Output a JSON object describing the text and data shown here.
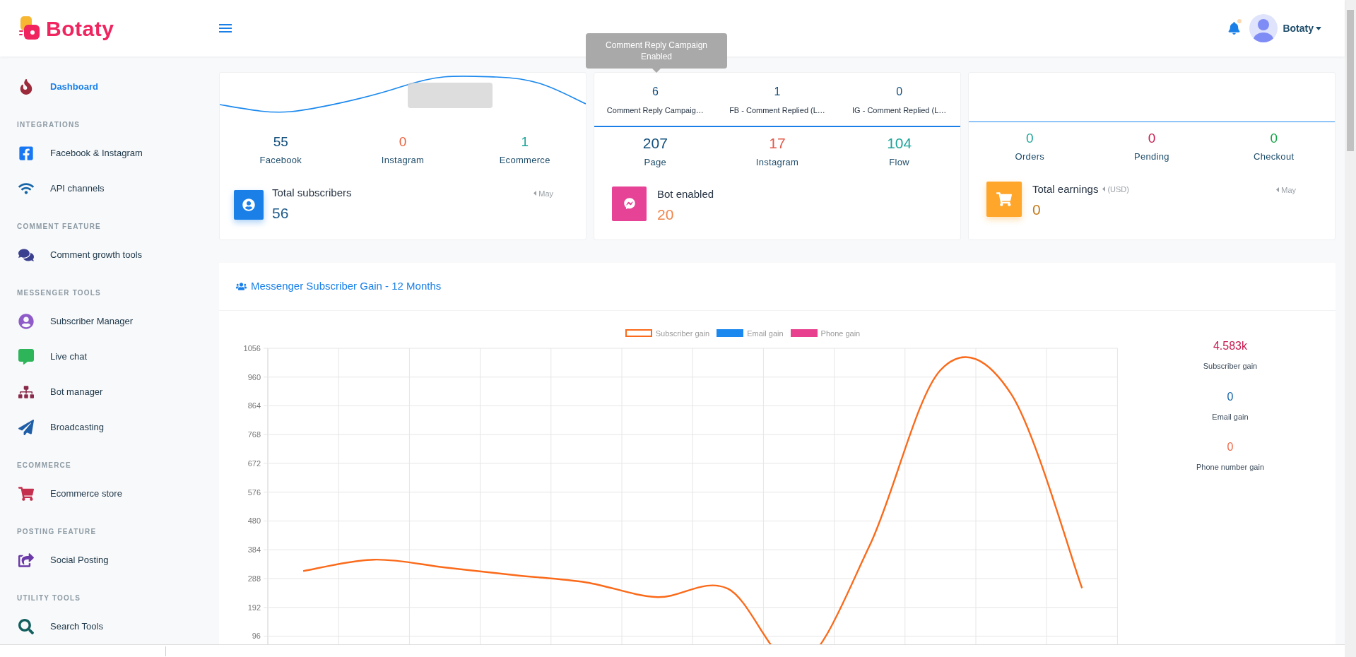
{
  "brand": {
    "name": "Botaty"
  },
  "header": {
    "user_name": "Botaty",
    "notification_dot": true
  },
  "sidebar": {
    "items": [
      {
        "kind": "link",
        "label": "Dashboard",
        "selected": true
      },
      {
        "kind": "heading",
        "label": "INTEGRATIONS"
      },
      {
        "kind": "link",
        "label": "Facebook & Instagram",
        "selected": false
      },
      {
        "kind": "link",
        "label": "API channels",
        "selected": false
      },
      {
        "kind": "heading",
        "label": "COMMENT FEATURE"
      },
      {
        "kind": "link",
        "label": "Comment growth tools",
        "selected": false
      },
      {
        "kind": "heading",
        "label": "MESSENGER TOOLS"
      },
      {
        "kind": "link",
        "label": "Subscriber Manager",
        "selected": false
      },
      {
        "kind": "link",
        "label": "Live chat",
        "selected": false
      },
      {
        "kind": "link",
        "label": "Bot manager",
        "selected": false
      },
      {
        "kind": "link",
        "label": "Broadcasting",
        "selected": false
      },
      {
        "kind": "heading",
        "label": "ECOMMERCE"
      },
      {
        "kind": "link",
        "label": "Ecommerce store",
        "selected": false
      },
      {
        "kind": "heading",
        "label": "POSTING FEATURE"
      },
      {
        "kind": "link",
        "label": "Social Posting",
        "selected": false
      },
      {
        "kind": "heading",
        "label": "UTILITY TOOLS"
      },
      {
        "kind": "link",
        "label": "Search Tools",
        "selected": false
      }
    ]
  },
  "subscribers_card": {
    "stats": [
      {
        "value": "55",
        "label": "Facebook",
        "color": "#134f7c"
      },
      {
        "value": "0",
        "label": "Instagram",
        "color": "#e8603c"
      },
      {
        "value": "1",
        "label": "Ecommerce",
        "color": "#1ea59a"
      }
    ],
    "summary": {
      "title": "Total subscribers",
      "value": "56",
      "period": "May"
    }
  },
  "tooltip": {
    "text": "Comment Reply Campaign Enabled"
  },
  "comments_card": {
    "top_stats": [
      {
        "value": "6",
        "label": "Comment Reply Campaig…"
      },
      {
        "value": "1",
        "label": "FB - Comment Replied (L…"
      },
      {
        "value": "0",
        "label": "IG - Comment Replied (L…"
      }
    ],
    "stats": [
      {
        "value": "207",
        "label": "Page",
        "color": "#134f7c"
      },
      {
        "value": "17",
        "label": "Instagram",
        "color": "#e25a4a"
      },
      {
        "value": "104",
        "label": "Flow",
        "color": "#1ea59a"
      }
    ],
    "summary": {
      "title": "Bot enabled",
      "value": "20"
    }
  },
  "ecommerce_card": {
    "stats": [
      {
        "value": "0",
        "label": "Orders",
        "color": "#1ea59a"
      },
      {
        "value": "0",
        "label": "Pending",
        "color": "#c8194f"
      },
      {
        "value": "0",
        "label": "Checkout",
        "color": "#17a54a"
      }
    ],
    "summary": {
      "title": "Total earnings",
      "currency": "(USD)",
      "value": "0",
      "period": "May"
    }
  },
  "gain_panel": {
    "title": "Messenger Subscriber Gain - 12 Months",
    "chart_data": {
      "type": "line",
      "grid": true,
      "legend": true,
      "ylim": [
        -35,
        1056
      ],
      "yticks": [
        96,
        192,
        288,
        384,
        480,
        576,
        672,
        768,
        864,
        960,
        1056
      ],
      "series": [
        {
          "name": "Subscriber gain",
          "color": "#fb6a1a",
          "values": [
            313,
            351,
            325,
            299,
            275,
            226,
            254,
            0,
            398,
            983,
            903,
            256
          ]
        },
        {
          "name": "Email gain",
          "color": "#1a88ee",
          "values": [
            null,
            null,
            null,
            null,
            null,
            null,
            null,
            null,
            null,
            null,
            null,
            null
          ]
        },
        {
          "name": "Phone gain",
          "color": "#e8408f",
          "values": [
            null,
            null,
            null,
            null,
            null,
            null,
            null,
            null,
            null,
            null,
            null,
            null
          ]
        }
      ]
    },
    "totals": [
      {
        "value": "4.583k",
        "label": "Subscriber gain",
        "color": "#c8194f"
      },
      {
        "value": "0",
        "label": "Email gain",
        "color": "#1565a8"
      },
      {
        "value": "0",
        "label": "Phone number gain",
        "color": "#ee6a4a"
      }
    ]
  }
}
